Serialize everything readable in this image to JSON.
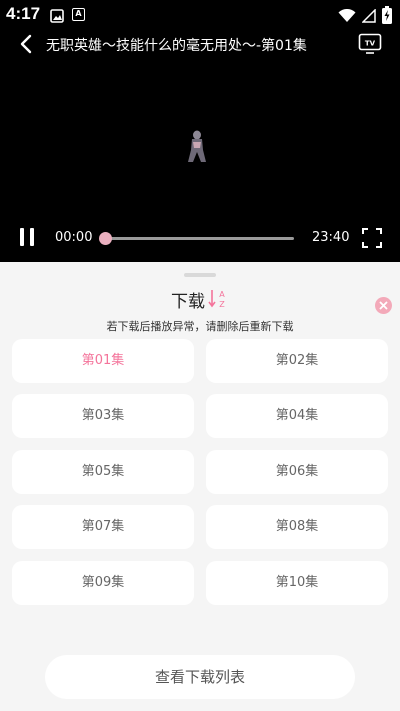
{
  "status": {
    "time": "4:17",
    "notif_icons": [
      "image-icon",
      "a-letter-icon"
    ],
    "right_icons": [
      "wifi-icon",
      "signal-icon",
      "battery-charging-icon"
    ]
  },
  "player": {
    "title": "无职英雄～技能什么的毫无用处～-第01集",
    "current_time": "00:00",
    "duration": "23:40",
    "progress": 0
  },
  "sheet": {
    "title": "下载",
    "notice": "若下载后播放异常，请删除后重新下载",
    "episodes": [
      "第01集",
      "第02集",
      "第03集",
      "第04集",
      "第05集",
      "第06集",
      "第07集",
      "第08集",
      "第09集",
      "第10集"
    ],
    "selected": "第01集",
    "view_list_label": "查看下载列表",
    "accent": "#f4749b"
  }
}
